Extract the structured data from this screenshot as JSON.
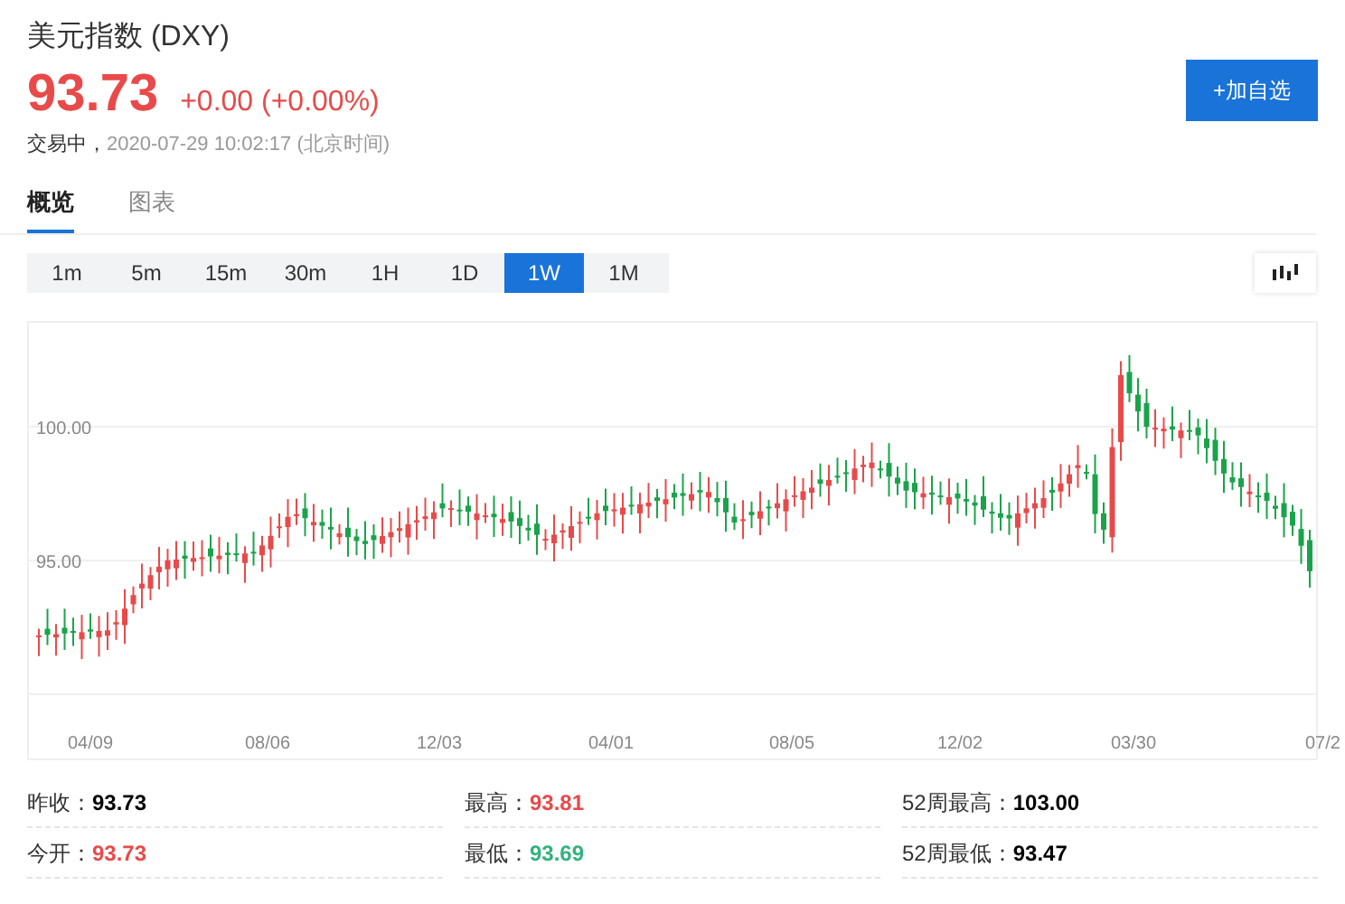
{
  "header": {
    "title": "美元指数 (DXY)",
    "price": "93.73",
    "change": "+0.00 (+0.00%)",
    "color": "#e84a4a",
    "status": "交易中，",
    "time": "2020-07-29 10:02:17 (北京时间)",
    "watch_button": "+加自选"
  },
  "tabs": [
    {
      "label": "概览",
      "selected": true
    },
    {
      "label": "图表",
      "selected": false
    }
  ],
  "intervals": [
    {
      "label": "1m",
      "selected": false
    },
    {
      "label": "5m",
      "selected": false
    },
    {
      "label": "15m",
      "selected": false
    },
    {
      "label": "30m",
      "selected": false
    },
    {
      "label": "1H",
      "selected": false
    },
    {
      "label": "1D",
      "selected": false
    },
    {
      "label": "1W",
      "selected": true
    },
    {
      "label": "1M",
      "selected": false
    }
  ],
  "chart": {
    "y_labels": [
      "100.00",
      "95.00"
    ],
    "x_labels": [
      "04/09",
      "08/06",
      "12/03",
      "04/01",
      "08/05",
      "12/02",
      "03/30",
      "07/2"
    ]
  },
  "stats": [
    {
      "label": "昨收：",
      "value": "93.73",
      "color": "#000000"
    },
    {
      "label": "最高：",
      "value": "93.81",
      "color": "#e84a4a"
    },
    {
      "label": "52周最高：",
      "value": "103.00",
      "color": "#000000"
    },
    {
      "label": "今开：",
      "value": "93.73",
      "color": "#e84a4a"
    },
    {
      "label": "最低：",
      "value": "93.69",
      "color": "#2fb37a"
    },
    {
      "label": "52周最低：",
      "value": "93.47",
      "color": "#000000"
    }
  ]
}
